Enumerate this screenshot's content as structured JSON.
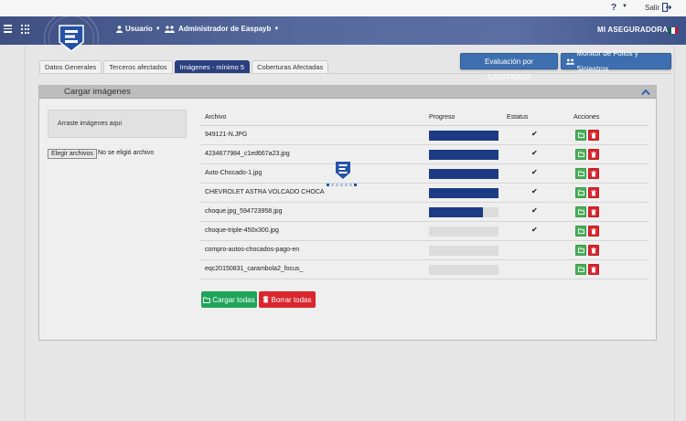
{
  "topbar": {
    "icon": "question-flag-icon",
    "exit_label": "Salir"
  },
  "nav": {
    "user_label": "Usuario",
    "admin_label": "Administrador de Easpayb",
    "brand": "MI ASEGURADORA",
    "flag_colors": [
      "#006847",
      "#ffffff",
      "#ce1126"
    ]
  },
  "tabs": [
    {
      "label": "Datos Generales",
      "active": false
    },
    {
      "label": "Terceros afectados",
      "active": false
    },
    {
      "label": "Imágenes - mínimo 5",
      "active": true
    },
    {
      "label": "Coberturas Afectadas",
      "active": false
    }
  ],
  "actions": {
    "evaluacion": "Evaluación por AJUSTADOR",
    "monitor": "Monitor de Folios y Siniestros"
  },
  "panel": {
    "title": "Cargar imágenes",
    "dropzone": "Arraste imágenes aqui",
    "file_button": "Elegir archivos",
    "file_none": "No se eligió archivo"
  },
  "table": {
    "headers": [
      "Archivo",
      "Progreso",
      "Estatus",
      "Acciones"
    ],
    "rows": [
      {
        "file": "949121-N.JPG",
        "progress": 1.0,
        "done": true
      },
      {
        "file": "4234677984_c1ed667a23.jpg",
        "progress": 1.0,
        "done": true
      },
      {
        "file": "Auto-Chocado-1.jpg",
        "progress": 1.0,
        "done": true
      },
      {
        "file": "CHEVROLET ASTRA VOLCADO CHOCA",
        "progress": 1.0,
        "done": true
      },
      {
        "file": "choque.jpg_594723958.jpg",
        "progress": 0.78,
        "done": true
      },
      {
        "file": "choque-triple-450x300.jpg",
        "progress": 0,
        "done": true
      },
      {
        "file": "compro-autos-chocados-pago-en",
        "progress": 0,
        "done": false
      },
      {
        "file": "eqc20150831_carambola2_focus_",
        "progress": 0,
        "done": false
      }
    ],
    "check_glyph": "✔"
  },
  "bulk": {
    "upload_all": "Cargar todas",
    "delete_all": "Borrar todas"
  },
  "colors": {
    "navy": "#2a3f7e",
    "progress": "#1e3a85",
    "green": "#1fa55a",
    "red": "#d9262e"
  }
}
